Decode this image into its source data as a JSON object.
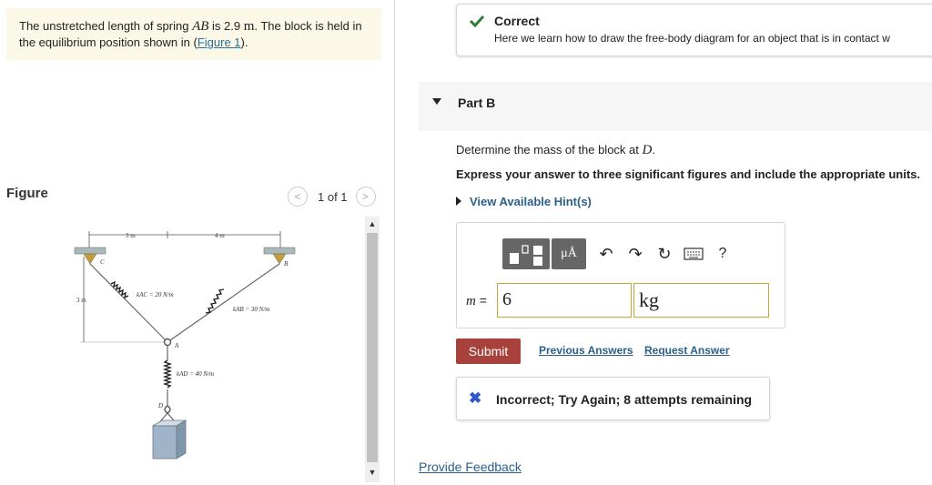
{
  "problem": {
    "text_before": "The unstretched length of spring ",
    "spring_name": "AB",
    "text_is": " is 2.9 ",
    "unit": "m",
    "text_after": ". The block is held in the equilibrium position shown in (",
    "figure_link": "Figure 1",
    "text_close": ")."
  },
  "figure": {
    "title": "Figure",
    "page_indicator": "1 of 1",
    "dim_top_left": "3 m",
    "dim_top_right": "4 m",
    "dim_left": "3 m",
    "label_B": "B",
    "label_C": "C",
    "label_A": "A",
    "label_D": "D",
    "k_ac": "kAC = 20 N/m",
    "k_ab": "kAB = 30 N/m",
    "k_ad": "kAD = 40 N/m"
  },
  "feedback_correct": {
    "title": "Correct",
    "message": "Here we learn how to draw the free-body diagram for an object that is in contact w"
  },
  "part_b": {
    "label": "Part B",
    "question_prefix": "Determine the mass of the block at ",
    "question_var": "D",
    "question_suffix": ".",
    "instruction": "Express your answer to three significant figures and include the appropriate units.",
    "hints_label": "View Available Hint(s)"
  },
  "answer": {
    "var_label": "m",
    "equals": " =",
    "value": "6",
    "unit": "kg",
    "toolbar": {
      "mu_label": "μÅ",
      "help_label": "?"
    }
  },
  "actions": {
    "submit_label": "Submit",
    "previous_answers": "Previous Answers",
    "request_answer": "Request Answer"
  },
  "result": {
    "message": "Incorrect; Try Again; 8 attempts remaining"
  },
  "footer": {
    "provide_feedback": "Provide Feedback"
  }
}
